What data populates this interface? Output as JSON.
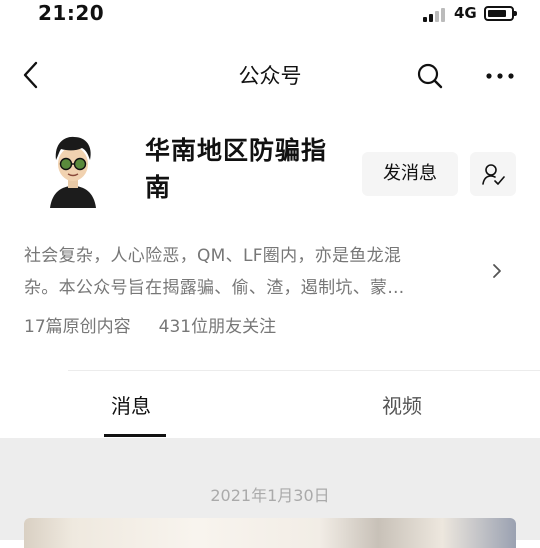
{
  "status_bar": {
    "time": "21:20",
    "network": "4G",
    "battery_level": 0.8
  },
  "nav": {
    "title": "公众号",
    "icons": [
      "back-icon",
      "search-icon",
      "more-icon"
    ]
  },
  "profile": {
    "name": "华南地区防骗指南",
    "message_button": "发消息",
    "intro_lines": [
      "社会复杂，人心险恶，QM、LF圈内，亦是鱼龙混",
      "杂。本公众号旨在揭露骗、偷、渣，遏制坑、蒙…"
    ],
    "stats": {
      "original_articles": "17篇原创内容",
      "friends_following": "431位朋友关注"
    }
  },
  "tabs": [
    {
      "label": "消息",
      "active": true
    },
    {
      "label": "视频",
      "active": false
    }
  ],
  "feed": {
    "date": "2021年1月30日"
  },
  "colors": {
    "page_bg": "#ffffff",
    "feed_bg": "#ededed",
    "button_bg": "#f5f5f5",
    "secondary_text": "#777777"
  }
}
